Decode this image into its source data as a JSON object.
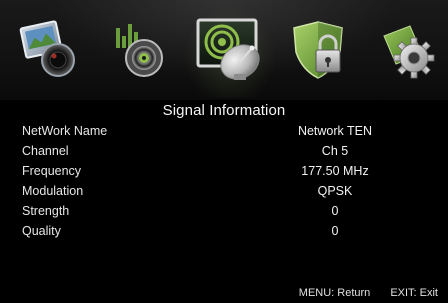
{
  "menu": {
    "icons": [
      {
        "name": "picture-icon",
        "selected": false
      },
      {
        "name": "sound-icon",
        "selected": false
      },
      {
        "name": "channel-satellite-icon",
        "selected": true
      },
      {
        "name": "lock-icon",
        "selected": false
      },
      {
        "name": "setup-gear-icon",
        "selected": false
      }
    ]
  },
  "panel": {
    "title": "Signal Information",
    "rows": [
      {
        "label": "NetWork Name",
        "value": "Network TEN"
      },
      {
        "label": "Channel",
        "value": "Ch 5"
      },
      {
        "label": "Frequency",
        "value": "177.50 MHz"
      },
      {
        "label": "Modulation",
        "value": "QPSK"
      },
      {
        "label": "Strength",
        "value": "0"
      },
      {
        "label": "Quality",
        "value": "0"
      }
    ]
  },
  "footer": {
    "menu_hint": "MENU: Return",
    "exit_hint": "EXIT: Exit"
  },
  "colors": {
    "background": "#000000",
    "text": "#f2f2f2",
    "selected_accent": "#8fbf4a"
  }
}
